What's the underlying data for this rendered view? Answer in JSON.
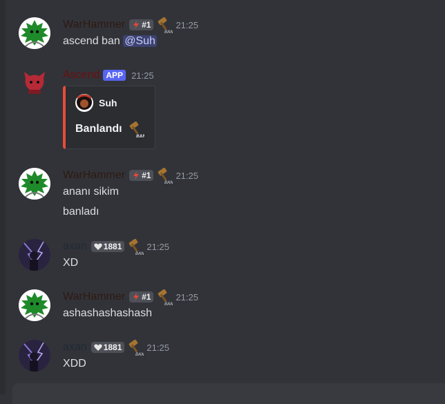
{
  "colors": {
    "warhammer_name": "#2e1a12",
    "ascend_name": "#6b0f0f",
    "axan_name": "#1f2a33",
    "embed_bar": "#e74c3c"
  },
  "messages": [
    {
      "author": "WarHammer",
      "badge_icon": "lightning-icon",
      "badge": "#1",
      "time": "21:25",
      "lines": [
        "ascend ban "
      ],
      "mention": "@Suh"
    },
    {
      "author": "Ascend",
      "app_tag": "APP",
      "time": "21:25",
      "embed": {
        "author": "Suh",
        "title": "Banlandı"
      }
    },
    {
      "author": "WarHammer",
      "badge": "#1",
      "time": "21:25",
      "lines": [
        "ananı sikim",
        "banladı"
      ]
    },
    {
      "author": "axan",
      "badge_icon": "heart-icon",
      "badge": "1881",
      "time": "21:25",
      "lines": [
        "XD"
      ]
    },
    {
      "author": "WarHammer",
      "badge": "#1",
      "time": "21:25",
      "lines": [
        "ashashashashash"
      ]
    },
    {
      "author": "axan",
      "badge": "1881",
      "time": "21:25",
      "lines": [
        "XDD"
      ]
    }
  ]
}
